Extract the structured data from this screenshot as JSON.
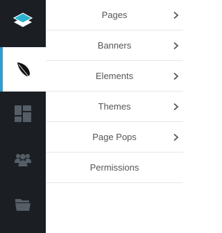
{
  "rail": {
    "items": [
      {
        "name": "layers",
        "icon": "layers-icon",
        "active": false
      },
      {
        "name": "feather",
        "icon": "feather-icon",
        "active": true
      },
      {
        "name": "dashboard",
        "icon": "dashboard-icon",
        "active": false
      },
      {
        "name": "users",
        "icon": "users-icon",
        "active": false
      },
      {
        "name": "folder",
        "icon": "folder-open-icon",
        "active": false
      }
    ],
    "active_indicator_color": "#2a9fd6",
    "background": "#1b1f24"
  },
  "menu": {
    "items": [
      {
        "label": "Pages",
        "has_submenu": true
      },
      {
        "label": "Banners",
        "has_submenu": true
      },
      {
        "label": "Elements",
        "has_submenu": true
      },
      {
        "label": "Themes",
        "has_submenu": true
      },
      {
        "label": "Page Pops",
        "has_submenu": true
      },
      {
        "label": "Permissions",
        "has_submenu": false
      }
    ]
  }
}
